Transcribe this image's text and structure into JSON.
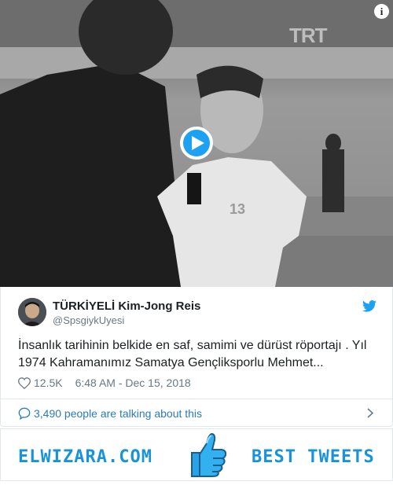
{
  "video": {
    "watermark": "TRT",
    "jersey_number": "13",
    "play_icon": "play-icon",
    "info_icon": "info-icon",
    "info_glyph": "i",
    "accent_color": "#1da1f2"
  },
  "tweet": {
    "display_name": "TÜRKİYELİ Kim-Jong Reis",
    "handle": "@SpsgiykUyesi",
    "text": "İnsanlık tarihinin belkide en saf, samimi ve dürüst röportajı . Yıl 1974 Kahramanımız Samatya Gençliksporlu Mehmet...",
    "likes": "12.5K",
    "timestamp": "6:48 AM - Dec 15, 2018",
    "brand_icon": "twitter-bird-icon",
    "like_icon": "heart-icon",
    "brand_color": "#1da1f2",
    "muted_color": "#697882"
  },
  "talking": {
    "text": "3,490 people are talking about this",
    "icon": "speech-bubble-icon",
    "link_color": "#2b7bb9"
  },
  "banner": {
    "site_name": "ELWIZARA.COM",
    "tagline": "BEST TWEETS",
    "icon": "thumbs-up-icon",
    "color": "#1893d9"
  }
}
